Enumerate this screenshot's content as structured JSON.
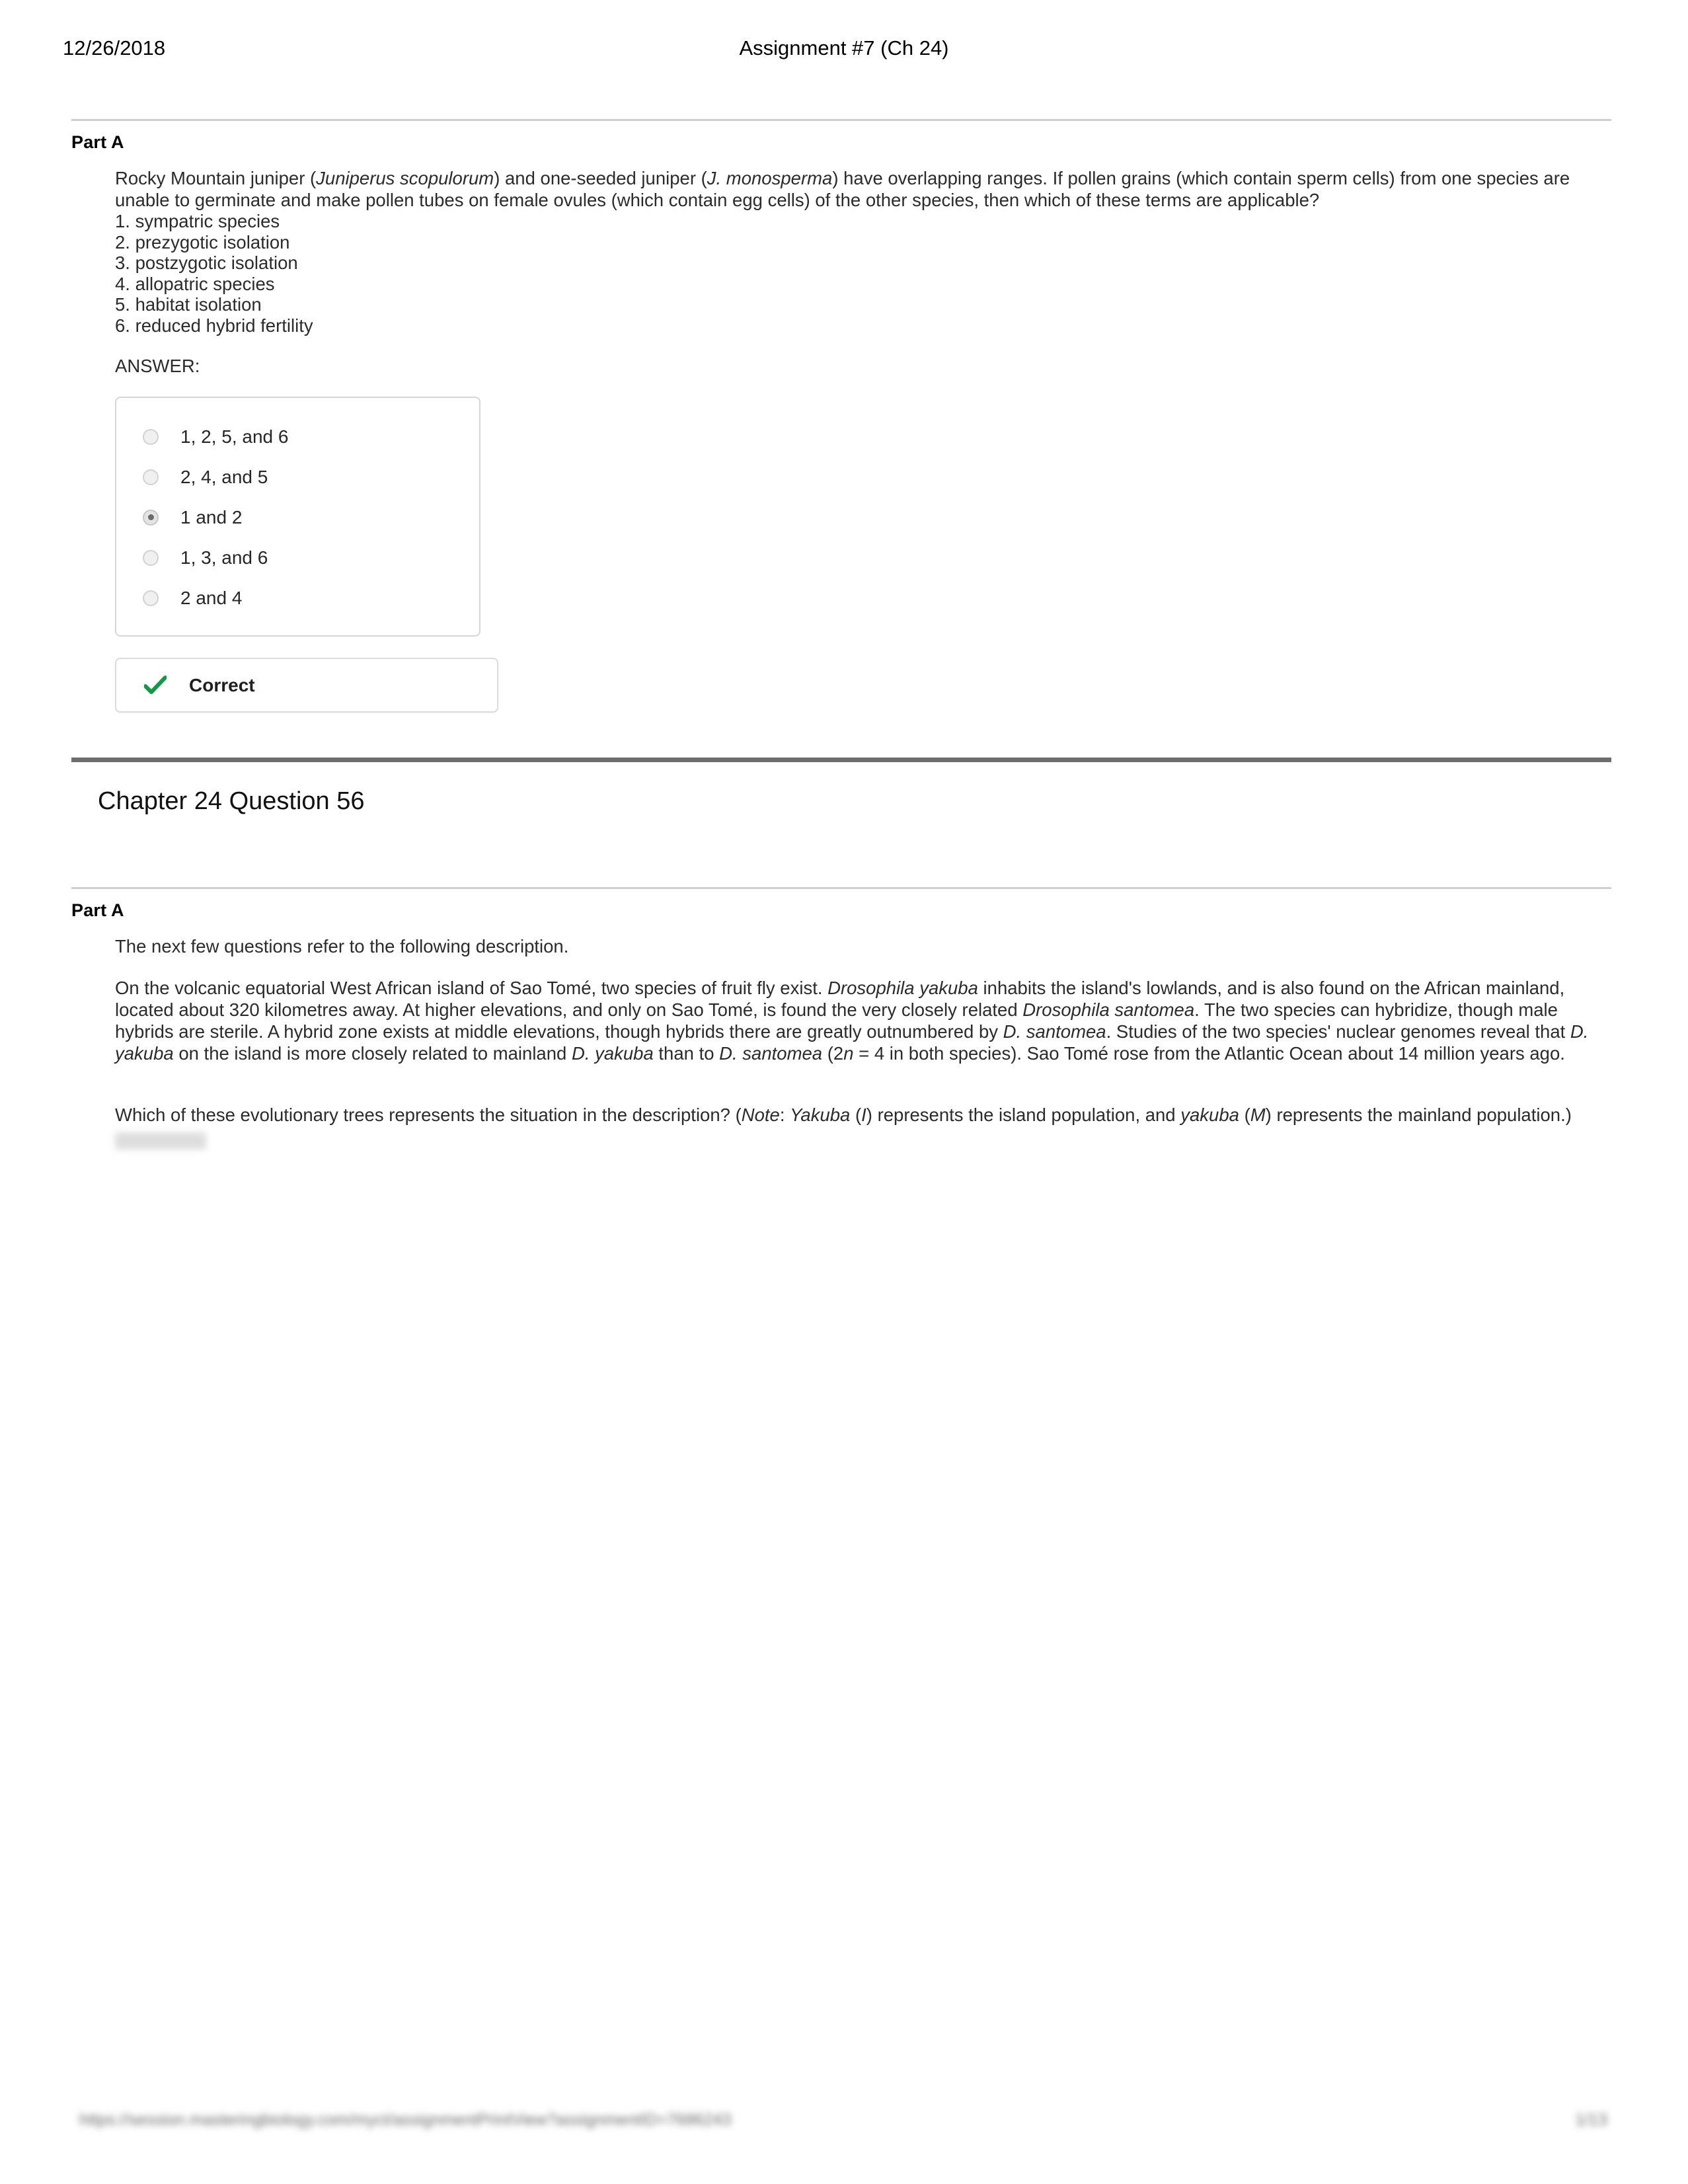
{
  "header": {
    "date": "12/26/2018",
    "title": "Assignment #7 (Ch 24)"
  },
  "section1": {
    "part_label": "Part A",
    "question_html": "Rocky Mountain juniper (<i>Juniperus scopulorum</i>) and one-seeded juniper (<i>J. monosperma</i>) have overlapping ranges. If pollen grains (which contain sperm cells) from one species are unable to germinate and make pollen tubes on female ovules (which contain egg cells) of the other species, then which of these terms are applicable?",
    "terms": [
      "1. sympatric species",
      "2. prezygotic isolation",
      "3. postzygotic isolation",
      "4. allopatric species",
      "5. habitat isolation",
      "6. reduced hybrid fertility"
    ],
    "answer_label": "ANSWER:",
    "options": [
      {
        "label": "1, 2, 5, and 6",
        "selected": false
      },
      {
        "label": "2, 4, and 5",
        "selected": false
      },
      {
        "label": "1 and 2",
        "selected": true
      },
      {
        "label": "1, 3, and 6",
        "selected": false
      },
      {
        "label": "2 and 4",
        "selected": false
      }
    ],
    "feedback": {
      "text": "Correct",
      "icon": "checkmark-icon",
      "color": "#119944"
    }
  },
  "chapter": {
    "title": "Chapter 24 Question 56"
  },
  "section2": {
    "part_label": "Part A",
    "intro": "The next few questions refer to the following description.",
    "description_html": "On the volcanic equatorial West African island of Sao Tomé, two species of fruit fly exist. <i>Drosophila yakuba</i> inhabits the island's lowlands, and is also found on the African mainland, located about 320 kilometres away. At higher elevations, and only on Sao Tomé, is found the very closely related <i>Drosophila santomea</i>. The two species can hybridize, though male hybrids are sterile. A hybrid zone exists at middle elevations, though hybrids there are greatly outnumbered by <i>D. santomea</i>. Studies of the two species' nuclear genomes reveal that <i>D. yakuba</i> on the island is more closely related to mainland <i>D. yakuba</i> than to <i>D. santomea</i> (2<i>n</i> = 4 in both species). Sao Tomé rose from the Atlantic Ocean about 14 million years ago.",
    "question_html": "Which of these evolutionary trees represents the situation in the description? (<i>Note</i>: <i>Yakuba</i> (<i>I</i>) represents the island population, and <i>yakuba</i> (<i>M</i>) represents the mainland population.)"
  },
  "footer": {
    "url": "https://session.masteringbiology.com/myct/assignmentPrintView?assignmentID=7686243",
    "page": "1/13"
  }
}
